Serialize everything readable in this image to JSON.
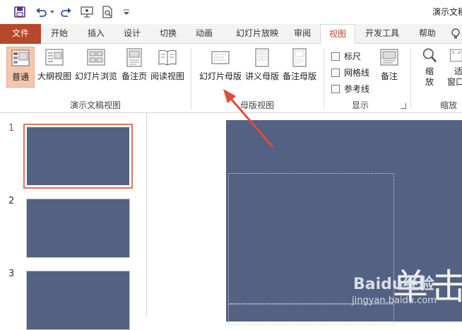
{
  "window": {
    "title": "演示文稿"
  },
  "qat": {
    "icons": [
      "save-icon",
      "undo-icon",
      "redo-icon",
      "present-icon",
      "print-preview-icon",
      "customize-icon"
    ]
  },
  "tabs": [
    {
      "label": "文件",
      "state": "file"
    },
    {
      "label": "开始"
    },
    {
      "label": "插入"
    },
    {
      "label": "设计"
    },
    {
      "label": "切换"
    },
    {
      "label": "动画"
    },
    {
      "label": "幻灯片放映"
    },
    {
      "label": "审阅"
    },
    {
      "label": "视图",
      "state": "active"
    },
    {
      "label": "开发工具"
    },
    {
      "label": "帮助"
    }
  ],
  "ribbon": {
    "groups": {
      "presentation_views": {
        "label": "演示文稿视图",
        "buttons": [
          "普通",
          "大纲视图",
          "幻灯片浏览",
          "备注页",
          "阅读视图"
        ],
        "selected": "普通"
      },
      "master_views": {
        "label": "母版视图",
        "buttons": [
          "幻灯片母版",
          "讲义母版",
          "备注母版"
        ]
      },
      "show": {
        "label": "显示",
        "checkboxes": [
          {
            "label": "标尺",
            "checked": false
          },
          {
            "label": "网格线",
            "checked": false
          },
          {
            "label": "参考线",
            "checked": false
          }
        ],
        "notes_button": "备注"
      },
      "zoom": {
        "label": "缩放",
        "zoom_button": "缩放",
        "zoom_button_line2": "放",
        "fit_button_line1": "适",
        "fit_button_line2": "窗口"
      }
    }
  },
  "slides": [
    {
      "number": "1",
      "current": true
    },
    {
      "number": "2",
      "current": false
    },
    {
      "number": "3",
      "current": false
    }
  ],
  "colors": {
    "accent": "#b7472a",
    "slide_bg": "#536282",
    "selection": "#e1745a",
    "arrow": "#e04a3a"
  },
  "editor": {
    "visible_text": "单击"
  },
  "watermark": {
    "brand": "Baidu经验",
    "url": "jingyan.baidu.com"
  }
}
